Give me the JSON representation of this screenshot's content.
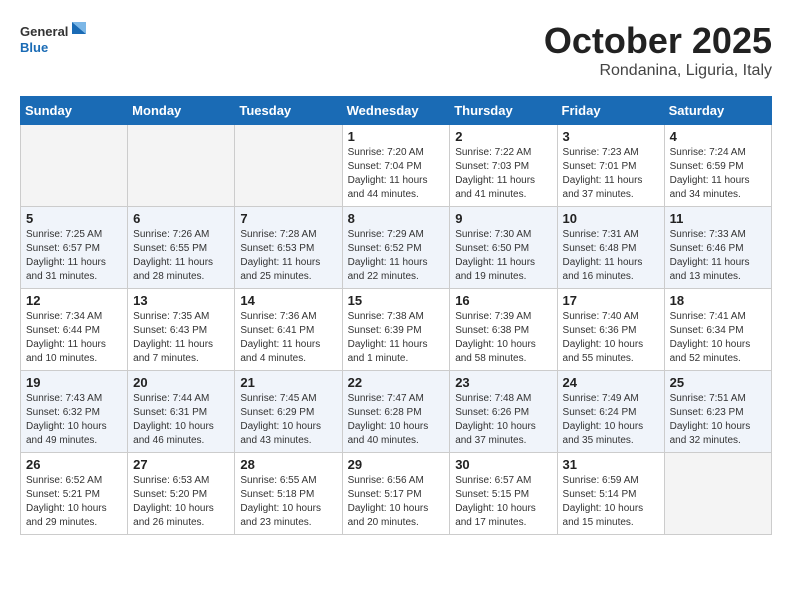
{
  "header": {
    "logo_general": "General",
    "logo_blue": "Blue",
    "month_title": "October 2025",
    "location": "Rondanina, Liguria, Italy"
  },
  "weekdays": [
    "Sunday",
    "Monday",
    "Tuesday",
    "Wednesday",
    "Thursday",
    "Friday",
    "Saturday"
  ],
  "weeks": [
    [
      {
        "day": "",
        "info": ""
      },
      {
        "day": "",
        "info": ""
      },
      {
        "day": "",
        "info": ""
      },
      {
        "day": "1",
        "info": "Sunrise: 7:20 AM\nSunset: 7:04 PM\nDaylight: 11 hours and 44 minutes."
      },
      {
        "day": "2",
        "info": "Sunrise: 7:22 AM\nSunset: 7:03 PM\nDaylight: 11 hours and 41 minutes."
      },
      {
        "day": "3",
        "info": "Sunrise: 7:23 AM\nSunset: 7:01 PM\nDaylight: 11 hours and 37 minutes."
      },
      {
        "day": "4",
        "info": "Sunrise: 7:24 AM\nSunset: 6:59 PM\nDaylight: 11 hours and 34 minutes."
      }
    ],
    [
      {
        "day": "5",
        "info": "Sunrise: 7:25 AM\nSunset: 6:57 PM\nDaylight: 11 hours and 31 minutes."
      },
      {
        "day": "6",
        "info": "Sunrise: 7:26 AM\nSunset: 6:55 PM\nDaylight: 11 hours and 28 minutes."
      },
      {
        "day": "7",
        "info": "Sunrise: 7:28 AM\nSunset: 6:53 PM\nDaylight: 11 hours and 25 minutes."
      },
      {
        "day": "8",
        "info": "Sunrise: 7:29 AM\nSunset: 6:52 PM\nDaylight: 11 hours and 22 minutes."
      },
      {
        "day": "9",
        "info": "Sunrise: 7:30 AM\nSunset: 6:50 PM\nDaylight: 11 hours and 19 minutes."
      },
      {
        "day": "10",
        "info": "Sunrise: 7:31 AM\nSunset: 6:48 PM\nDaylight: 11 hours and 16 minutes."
      },
      {
        "day": "11",
        "info": "Sunrise: 7:33 AM\nSunset: 6:46 PM\nDaylight: 11 hours and 13 minutes."
      }
    ],
    [
      {
        "day": "12",
        "info": "Sunrise: 7:34 AM\nSunset: 6:44 PM\nDaylight: 11 hours and 10 minutes."
      },
      {
        "day": "13",
        "info": "Sunrise: 7:35 AM\nSunset: 6:43 PM\nDaylight: 11 hours and 7 minutes."
      },
      {
        "day": "14",
        "info": "Sunrise: 7:36 AM\nSunset: 6:41 PM\nDaylight: 11 hours and 4 minutes."
      },
      {
        "day": "15",
        "info": "Sunrise: 7:38 AM\nSunset: 6:39 PM\nDaylight: 11 hours and 1 minute."
      },
      {
        "day": "16",
        "info": "Sunrise: 7:39 AM\nSunset: 6:38 PM\nDaylight: 10 hours and 58 minutes."
      },
      {
        "day": "17",
        "info": "Sunrise: 7:40 AM\nSunset: 6:36 PM\nDaylight: 10 hours and 55 minutes."
      },
      {
        "day": "18",
        "info": "Sunrise: 7:41 AM\nSunset: 6:34 PM\nDaylight: 10 hours and 52 minutes."
      }
    ],
    [
      {
        "day": "19",
        "info": "Sunrise: 7:43 AM\nSunset: 6:32 PM\nDaylight: 10 hours and 49 minutes."
      },
      {
        "day": "20",
        "info": "Sunrise: 7:44 AM\nSunset: 6:31 PM\nDaylight: 10 hours and 46 minutes."
      },
      {
        "day": "21",
        "info": "Sunrise: 7:45 AM\nSunset: 6:29 PM\nDaylight: 10 hours and 43 minutes."
      },
      {
        "day": "22",
        "info": "Sunrise: 7:47 AM\nSunset: 6:28 PM\nDaylight: 10 hours and 40 minutes."
      },
      {
        "day": "23",
        "info": "Sunrise: 7:48 AM\nSunset: 6:26 PM\nDaylight: 10 hours and 37 minutes."
      },
      {
        "day": "24",
        "info": "Sunrise: 7:49 AM\nSunset: 6:24 PM\nDaylight: 10 hours and 35 minutes."
      },
      {
        "day": "25",
        "info": "Sunrise: 7:51 AM\nSunset: 6:23 PM\nDaylight: 10 hours and 32 minutes."
      }
    ],
    [
      {
        "day": "26",
        "info": "Sunrise: 6:52 AM\nSunset: 5:21 PM\nDaylight: 10 hours and 29 minutes."
      },
      {
        "day": "27",
        "info": "Sunrise: 6:53 AM\nSunset: 5:20 PM\nDaylight: 10 hours and 26 minutes."
      },
      {
        "day": "28",
        "info": "Sunrise: 6:55 AM\nSunset: 5:18 PM\nDaylight: 10 hours and 23 minutes."
      },
      {
        "day": "29",
        "info": "Sunrise: 6:56 AM\nSunset: 5:17 PM\nDaylight: 10 hours and 20 minutes."
      },
      {
        "day": "30",
        "info": "Sunrise: 6:57 AM\nSunset: 5:15 PM\nDaylight: 10 hours and 17 minutes."
      },
      {
        "day": "31",
        "info": "Sunrise: 6:59 AM\nSunset: 5:14 PM\nDaylight: 10 hours and 15 minutes."
      },
      {
        "day": "",
        "info": ""
      }
    ]
  ]
}
